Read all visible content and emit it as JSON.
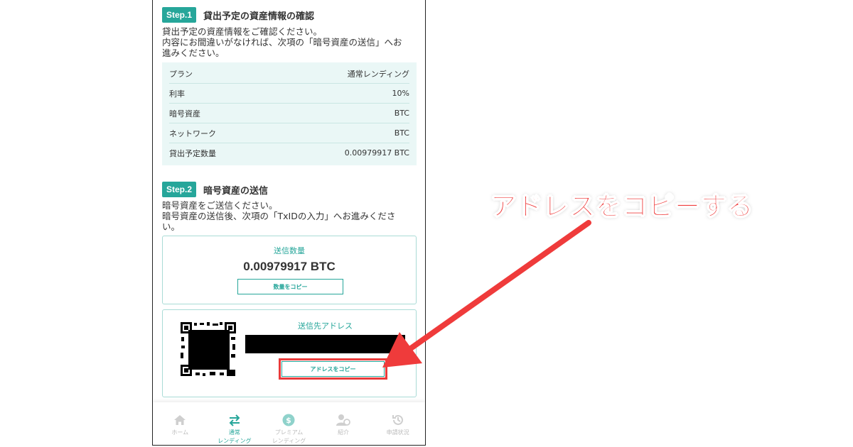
{
  "step1": {
    "badge": "Step.1",
    "title": "貸出予定の資産情報の確認",
    "desc_line1": "貸出予定の資産情報をご確認ください。",
    "desc_line2": "内容にお間違いがなければ、次項の「暗号資産の送信」へお",
    "desc_line3": "進みください。",
    "rows": [
      {
        "label": "プラン",
        "value": "通常レンディング"
      },
      {
        "label": "利率",
        "value": "10%"
      },
      {
        "label": "暗号資産",
        "value": "BTC"
      },
      {
        "label": "ネットワーク",
        "value": "BTC"
      },
      {
        "label": "貸出予定数量",
        "value": "0.00979917 BTC"
      }
    ]
  },
  "step2": {
    "badge": "Step.2",
    "title": "暗号資産の送信",
    "desc_line1": "暗号資産をご送信ください。",
    "desc_line2": "暗号資産の送信後、次項の「TxIDの入力」へお進みくださ",
    "desc_line3": "い。",
    "amount_label": "送信数量",
    "amount_value": "0.00979917 BTC",
    "copy_amount_label": "数量をコピー",
    "address_label": "送信先アドレス",
    "copy_address_label": "アドレスをコピー"
  },
  "nav": [
    {
      "label_line1": "ホーム",
      "label_line2": "",
      "icon": "home-icon"
    },
    {
      "label_line1": "通常",
      "label_line2": "レンディング",
      "icon": "swap-icon"
    },
    {
      "label_line1": "プレミアム",
      "label_line2": "レンディング",
      "icon": "dollar-coin-icon"
    },
    {
      "label_line1": "紹介",
      "label_line2": "",
      "icon": "users-icon"
    },
    {
      "label_line1": "申請状況",
      "label_line2": "",
      "icon": "history-icon"
    }
  ],
  "annotation": {
    "callout_text": "アドレスをコピーする"
  },
  "colors": {
    "accent": "#26a69a",
    "annotation_red": "#ef3b3b",
    "table_bg": "#eaf7f6"
  }
}
